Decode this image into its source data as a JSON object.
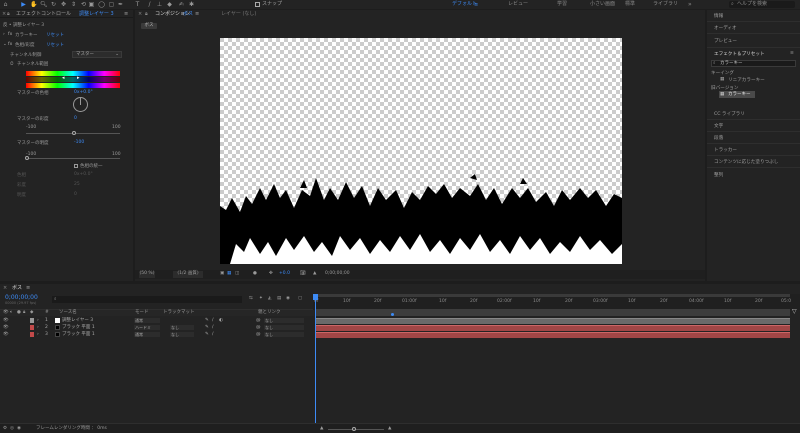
{
  "toolbar": {
    "snap_label": "スナップ",
    "workspaces": [
      "デフォルト",
      "レビュー",
      "学習",
      "小さい画面",
      "標準",
      "ライブラリ"
    ],
    "active_workspace": "デフォルト",
    "search_placeholder": "ヘルプを検索"
  },
  "effect_controls": {
    "tab_label": "エフェクトコントロール",
    "tab_layer": "調整レイヤー 3",
    "breadcrumb": "反 • 調整レイヤー 3",
    "fx1_name": "カラーキー",
    "fx1_reset": "リセット",
    "fx2_name": "色相/彩度",
    "fx2_reset": "リセット",
    "channel_control_label": "チャンネル制御",
    "channel_control_value": "マスター",
    "channel_range_label": "チャンネル範囲",
    "master_hue_label": "マスターの色相",
    "master_hue_value": "0x+0.0°",
    "master_sat_label": "マスターの彩度",
    "master_sat_value": "0",
    "sat_min": "-100",
    "sat_max": "100",
    "master_light_label": "マスターの明度",
    "master_light_value": "-100",
    "light_min": "-100",
    "light_max": "100",
    "colorize_label": "色相の統一",
    "colorize_hue_label": "色相",
    "colorize_hue_value": "0x+0.0°",
    "colorize_sat_label": "彩度",
    "colorize_sat_value": "25",
    "colorize_light_label": "明度",
    "colorize_light_value": "0"
  },
  "composition": {
    "tab_label": "コンポジション",
    "tab_name": "ボス",
    "layer_tab": "レイヤー (なし)",
    "subtab": "ボス",
    "zoom": "(50 %)",
    "resolution": "(1/2 画質)",
    "exposure": "+0.0",
    "timecode": "0;00;00;00"
  },
  "right_panel": {
    "items": [
      "情報",
      "オーディオ",
      "プレビュー",
      "エフェクト＆プリセット"
    ],
    "effects_search": "カラーキー",
    "group1": "キーイング",
    "group1_item": "リニアカラーキー",
    "group2": "旧バージョン",
    "group2_item": "カラーキー",
    "lower_items": [
      "CC ライブラリ",
      "文字",
      "段落",
      "トラッカー",
      "コンテンツに応じた塗りつぶし",
      "整列"
    ]
  },
  "timeline": {
    "comp_tab": "ボス",
    "timecode": "0;00;00;00",
    "timecode_sub": "00000 (29.97 fps)",
    "headers": {
      "source_name": "ソース名",
      "mode": "モード",
      "trkmat": "トラックマット",
      "parent": "親とリンク"
    },
    "layers": [
      {
        "num": "1",
        "name": "調整レイヤー 3",
        "mode": "通常",
        "trkmat": "",
        "parent": "なし",
        "color": "#9a9a9a"
      },
      {
        "num": "2",
        "name": "ブラック 平面 1",
        "mode": "ハードミ",
        "trkmat": "なし",
        "parent": "なし",
        "color": "#c24a4a"
      },
      {
        "num": "3",
        "name": "ブラック 平面 1",
        "mode": "通常",
        "trkmat": "なし",
        "parent": "なし",
        "color": "#c24a4a"
      }
    ],
    "ruler": [
      "0f",
      "10f",
      "20f",
      "01:00f",
      "10f",
      "20f",
      "02:00f",
      "10f",
      "20f",
      "03:00f",
      "10f",
      "20f",
      "04:00f",
      "10f",
      "20f",
      "05:0"
    ],
    "footer": "フレームレンダリング時間 ： 0ms"
  },
  "colors": {
    "accent": "#3d8bf6",
    "layer_bar": "#a14646",
    "adjustment_bar": "#6a6a6a",
    "panel_bg": "#232323"
  }
}
